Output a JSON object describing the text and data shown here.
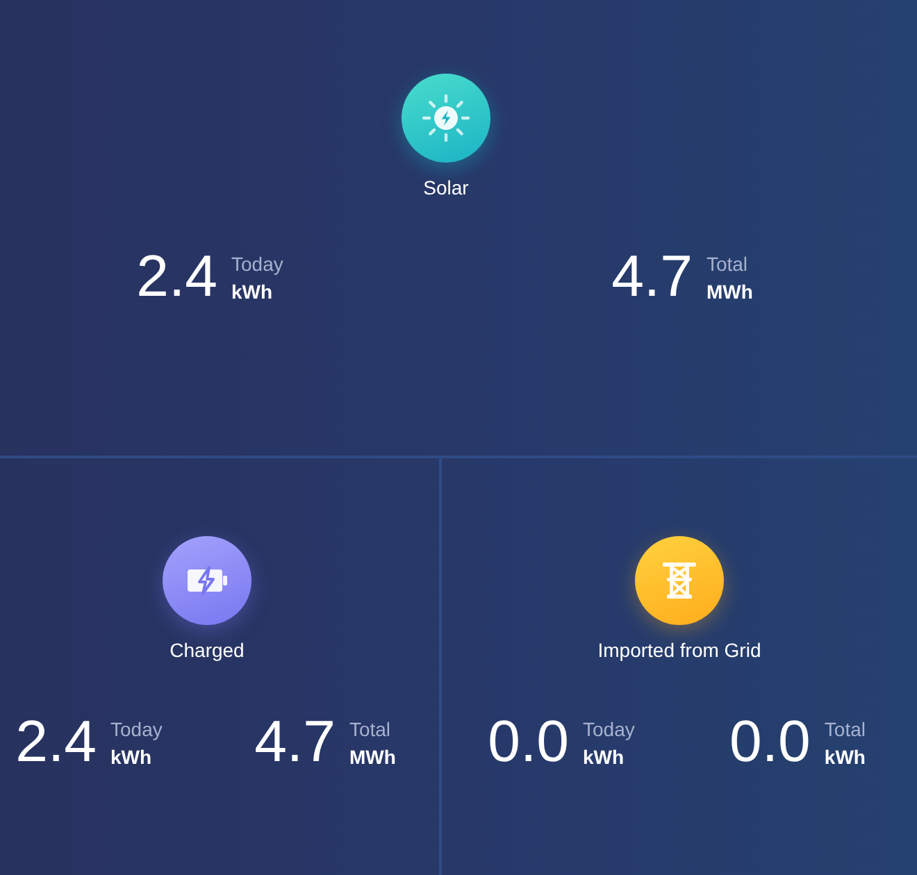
{
  "top_panel": {
    "kind": "solar",
    "label": "Solar",
    "stats": [
      {
        "value": "2.4",
        "period": "Today",
        "unit": "kWh"
      },
      {
        "value": "4.7",
        "period": "Total",
        "unit": "MWh"
      }
    ]
  },
  "bottom_panels": [
    {
      "kind": "battery",
      "label": "Charged",
      "stats": [
        {
          "value": "2.4",
          "period": "Today",
          "unit": "kWh"
        },
        {
          "value": "4.7",
          "period": "Total",
          "unit": "MWh"
        }
      ]
    },
    {
      "kind": "grid",
      "label": "Imported from Grid",
      "stats": [
        {
          "value": "0.0",
          "period": "Today",
          "unit": "kWh"
        },
        {
          "value": "0.0",
          "period": "Total",
          "unit": "kWh"
        }
      ]
    }
  ]
}
